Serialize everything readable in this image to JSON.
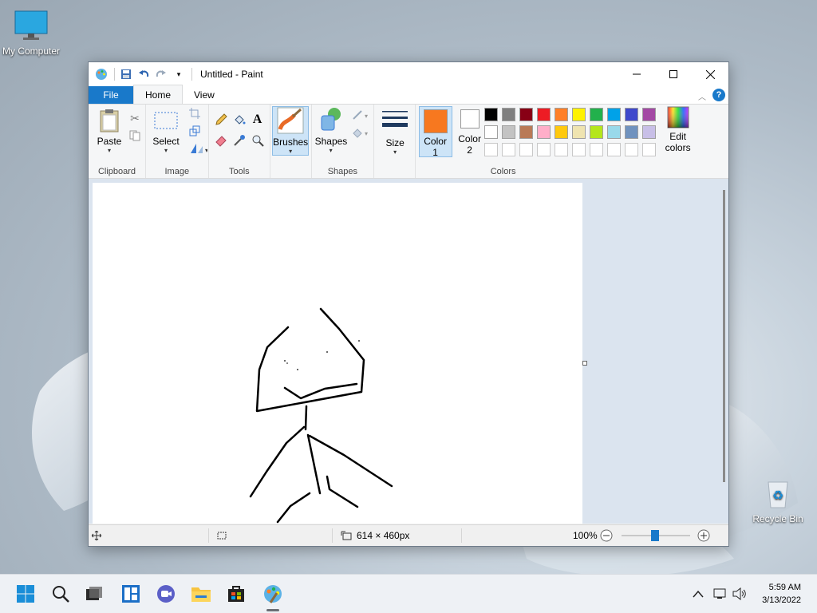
{
  "desktop": {
    "icons": [
      {
        "label": "My Computer"
      },
      {
        "label": "Recycle Bin"
      }
    ]
  },
  "window": {
    "title": "Untitled - Paint",
    "menu_tabs": [
      "File",
      "Home",
      "View"
    ],
    "help_label": "?"
  },
  "ribbon": {
    "clipboard": {
      "paste_label": "Paste",
      "group_label": "Clipboard"
    },
    "image": {
      "select_label": "Select",
      "group_label": "Image"
    },
    "tools": {
      "group_label": "Tools",
      "text_tool_glyph": "A"
    },
    "brushes": {
      "label": "Brushes"
    },
    "shapes": {
      "label": "Shapes",
      "group_label": "Shapes"
    },
    "size": {
      "label": "Size"
    },
    "color1": {
      "label_line1": "Color",
      "label_line2": "1",
      "value": "#f7781f"
    },
    "color2": {
      "label_line1": "Color",
      "label_line2": "2",
      "value": "#ffffff"
    },
    "colors": {
      "group_label": "Colors",
      "edit_line1": "Edit",
      "edit_line2": "colors",
      "row1": [
        "#000000",
        "#7f7f7f",
        "#880015",
        "#ed1c24",
        "#ff7f27",
        "#fff200",
        "#22b14c",
        "#00a2e8",
        "#3f48cc",
        "#a349a4"
      ],
      "row2": [
        "#ffffff",
        "#c3c3c3",
        "#b97a57",
        "#ffaec9",
        "#ffc90e",
        "#efe4b0",
        "#b5e61d",
        "#99d9ea",
        "#7092be",
        "#c8bfe7"
      ]
    }
  },
  "status": {
    "canvas_size": "614 × 460px",
    "zoom": "100%"
  },
  "taskbar": {
    "time": "5:59 AM",
    "date": "3/13/2022"
  }
}
